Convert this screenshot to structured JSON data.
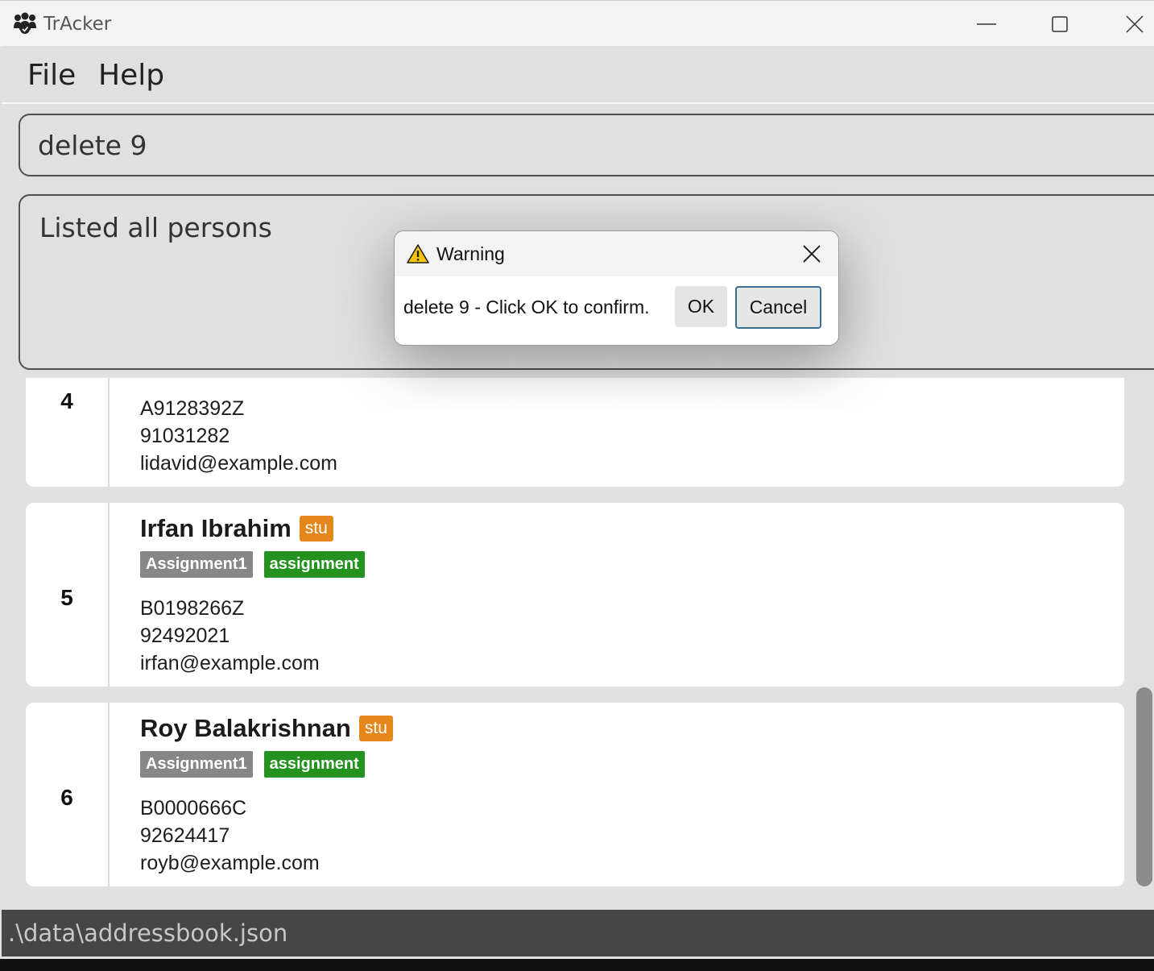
{
  "window": {
    "title": "TrAcker"
  },
  "menu": {
    "items": [
      "File",
      "Help"
    ]
  },
  "command": {
    "value": "delete 9"
  },
  "result": {
    "text": "Listed all persons"
  },
  "persons": [
    {
      "index": "4",
      "name": "",
      "tags": [],
      "id": "A9128392Z",
      "phone": "91031282",
      "email": "lidavid@example.com"
    },
    {
      "index": "5",
      "name": "Irfan Ibrahim",
      "badge": "stu",
      "tags": [
        "Assignment1",
        "assignment"
      ],
      "id": "B0198266Z",
      "phone": "92492021",
      "email": "irfan@example.com"
    },
    {
      "index": "6",
      "name": "Roy Balakrishnan",
      "badge": "stu",
      "tags": [
        "Assignment1",
        "assignment"
      ],
      "id": "B0000666C",
      "phone": "92624417",
      "email": "royb@example.com"
    }
  ],
  "status": {
    "path": ".\\data\\addressbook.json"
  },
  "dialog": {
    "title": "Warning",
    "message": "delete 9 - Click OK to confirm.",
    "ok_label": "OK",
    "cancel_label": "Cancel"
  },
  "colors": {
    "stu_badge": "#e5861a",
    "tag_grey": "#878787",
    "tag_green": "#24921f",
    "tag_red": "#e53935"
  }
}
